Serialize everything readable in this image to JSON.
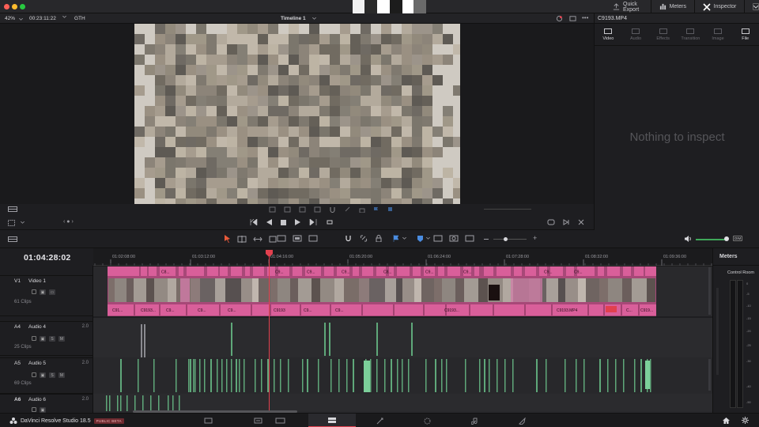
{
  "titlebar": {
    "quick_export": "Quick Export",
    "meters": "Meters",
    "inspector": "Inspector",
    "traffic_colors": [
      "#ff5f57",
      "#febc2e",
      "#28c840"
    ]
  },
  "viewer": {
    "zoom": "42%",
    "timecode": "00:23:11:22",
    "clip_label": "GTH",
    "timeline_name": "Timeline 1"
  },
  "inspector": {
    "clip_name": "C9193.MP4",
    "tabs": [
      {
        "label": "Video",
        "icon": "video-icon",
        "active": true
      },
      {
        "label": "Audio",
        "icon": "audio-icon",
        "active": false
      },
      {
        "label": "Effects",
        "icon": "effects-icon",
        "active": false
      },
      {
        "label": "Transition",
        "icon": "transition-icon",
        "active": false
      },
      {
        "label": "Image",
        "icon": "image-icon",
        "active": false
      },
      {
        "label": "File",
        "icon": "file-icon",
        "active": true
      }
    ],
    "empty_message": "Nothing to inspect"
  },
  "timeline": {
    "current_timecode": "01:04:28:02",
    "ruler_ticks": [
      "01:02:08:00",
      "01:03:12:00",
      "01:04:16:00",
      "01:05:20:00",
      "01:06:24:00",
      "01:07:28:00",
      "01:08:32:00",
      "01:09:36:00"
    ],
    "audio_readout": "DIM",
    "tracks": [
      {
        "id": "V1",
        "name": "Video 1",
        "clips": "61 Clips",
        "channels": ""
      },
      {
        "id": "A4",
        "name": "Audio 4",
        "clips": "25 Clips",
        "channels": "2.0"
      },
      {
        "id": "A5",
        "name": "Audio 5",
        "clips": "69 Clips",
        "channels": "2.0"
      },
      {
        "id": "A6",
        "name": "Audio 6",
        "clips": "",
        "channels": "2.0"
      }
    ],
    "top_clip_labels": [
      "C8...",
      "C9...",
      "C9...",
      "C9...",
      "C8...",
      "C9...",
      "C9...",
      "C9...",
      "C9..."
    ],
    "bottom_clip_labels": [
      "C91...",
      "C9193...",
      "C9...",
      "C9...",
      "C9...",
      "C9193",
      "C9...",
      "C9...",
      "C9193...",
      "C9193.MP4",
      "C...",
      "C919..."
    ],
    "colors": {
      "video_clip": "#d95f9a",
      "audio_clip": "#5fa87a",
      "playhead": "#e2404e"
    }
  },
  "meters": {
    "title": "Meters",
    "label": "Control Room",
    "scale": [
      "0",
      "-5",
      "-10",
      "-15",
      "-20",
      "-25",
      "-30",
      "-40",
      "-50"
    ]
  },
  "bottombar": {
    "app_name": "DaVinci Resolve Studio 18.5",
    "badge": "PUBLIC BETA"
  }
}
